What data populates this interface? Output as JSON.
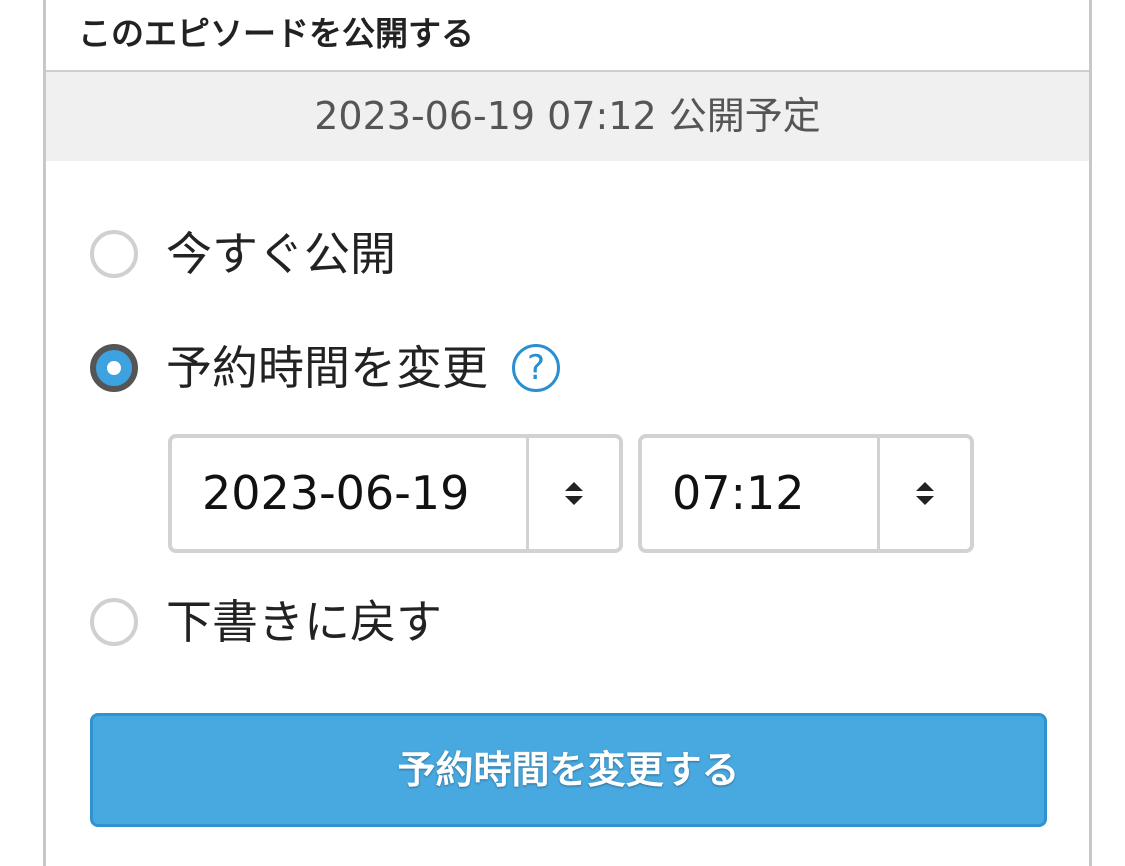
{
  "panel": {
    "heading": "このエピソードを公開する",
    "status": "2023-06-19 07:12 公開予定"
  },
  "options": {
    "publish_now": {
      "label": "今すぐ公開",
      "checked": false
    },
    "change_schedule": {
      "label": "予約時間を変更",
      "checked": true,
      "help_icon": "?"
    },
    "revert_draft": {
      "label": "下書きに戻す",
      "checked": false
    }
  },
  "schedule": {
    "date": "2023-06-19",
    "time": "07:12"
  },
  "submit": {
    "label": "予約時間を変更する"
  },
  "colors": {
    "accent": "#48a8e0",
    "help": "#2a8fd0"
  }
}
